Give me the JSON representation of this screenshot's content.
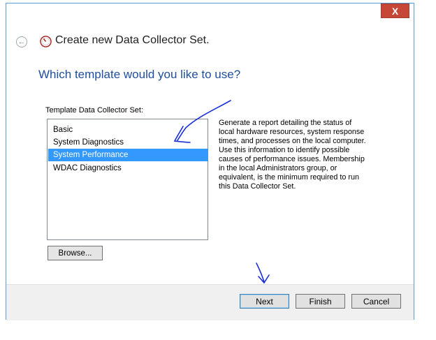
{
  "window": {
    "close_symbol": "X",
    "title": "Create new Data Collector Set."
  },
  "page": {
    "heading": "Which template would you like to use?",
    "list_label": "Template Data Collector Set:",
    "templates": [
      {
        "label": "Basic",
        "selected": false
      },
      {
        "label": "System Diagnostics",
        "selected": false
      },
      {
        "label": "System Performance",
        "selected": true
      },
      {
        "label": "WDAC Diagnostics",
        "selected": false
      }
    ],
    "description_lines": [
      "Generate a report detailing the status of",
      "local hardware resources, system response",
      "times, and processes on the local computer.",
      "Use this information to identify possible",
      "causes of performance issues. Membership",
      "in the local Administrators group, or",
      "equivalent, is the minimum required to run",
      "this Data Collector Set."
    ],
    "browse_label": "Browse..."
  },
  "footer": {
    "next_label": "Next",
    "finish_label": "Finish",
    "cancel_label": "Cancel"
  },
  "colors": {
    "selection": "#3399ff",
    "heading": "#1f4e9c",
    "close": "#c74737",
    "annotation_ink": "#1a2fd6"
  }
}
